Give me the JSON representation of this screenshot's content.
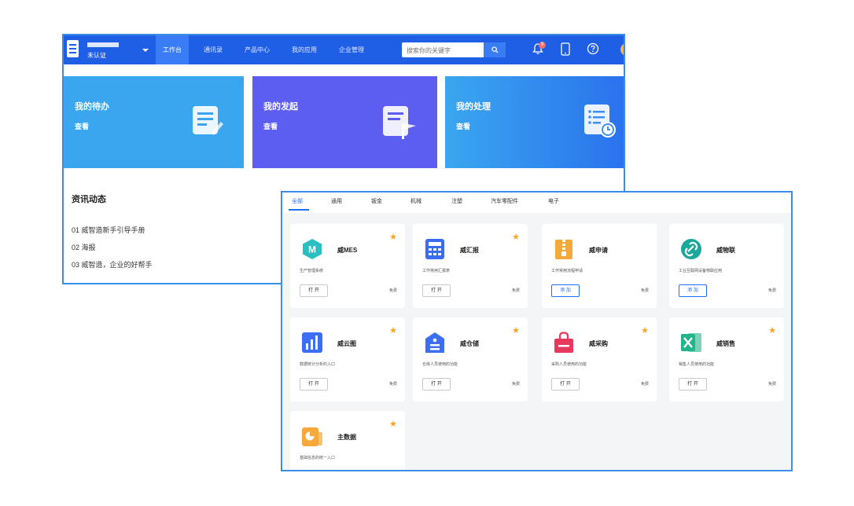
{
  "topbar": {
    "org_status": "未认证",
    "nav": [
      "工作台",
      "通讯录",
      "产品中心",
      "我的应用",
      "企业管理"
    ],
    "search_placeholder": "搜索你的关键字",
    "notification_count": "9",
    "brand_color": "#1f5fe6"
  },
  "cards": [
    {
      "title": "我的待办",
      "link": "查看",
      "color": "#3aa6ef",
      "icon": "document-edit-icon"
    },
    {
      "title": "我的发起",
      "link": "查看",
      "color": "#5b5ef0",
      "icon": "document-flag-icon"
    },
    {
      "title": "我的处理",
      "link": "查看",
      "color": "#3e8ef3",
      "icon": "list-clock-icon"
    }
  ],
  "news": {
    "title": "资讯动态",
    "items": [
      "01 威智造新手引导手册",
      "02 海报",
      "03 威智造，企业的好帮手"
    ]
  },
  "tabs": [
    "全部",
    "通用",
    "钣金",
    "机械",
    "注塑",
    "汽车零配件",
    "电子"
  ],
  "apps": [
    {
      "name": "威MES",
      "desc": "生产管理系统",
      "button": "打 开",
      "price": "免费",
      "color": "#2cbfc0",
      "icon": "hexagon-m-icon"
    },
    {
      "name": "威汇报",
      "desc": "工作常用汇报表",
      "button": "打 开",
      "price": "免费",
      "color": "#3a6cf0",
      "icon": "calculator-icon"
    },
    {
      "name": "威申请",
      "desc": "工作常用流程申请",
      "button": "添 加",
      "price": "免费",
      "color": "#f6a93b",
      "icon": "folder-zip-icon"
    },
    {
      "name": "威物联",
      "desc": "工业互联网设备物联应用",
      "button": "添 加",
      "price": "免费",
      "color": "#19a89a",
      "icon": "link-icon"
    },
    {
      "name": "威云图",
      "desc": "数据统计分析的入口",
      "button": "打 开",
      "price": "免费",
      "color": "#3b6ef2",
      "icon": "bar-chart-icon"
    },
    {
      "name": "威仓储",
      "desc": "仓库人员使用的功能",
      "button": "打 开",
      "price": "免费",
      "color": "#3b6ef2",
      "icon": "warehouse-icon"
    },
    {
      "name": "威采购",
      "desc": "采购人员使用的功能",
      "button": "打 开",
      "price": "免费",
      "color": "#e8385b",
      "icon": "shopping-bag-icon"
    },
    {
      "name": "威销售",
      "desc": "销售人员使用的功能",
      "button": "打 开",
      "price": "免费",
      "color": "#22b58a",
      "icon": "excel-icon"
    },
    {
      "name": "主数据",
      "desc": "基础信息的统一入口",
      "color": "#f6a93b",
      "icon": "pie-doc-icon"
    }
  ]
}
